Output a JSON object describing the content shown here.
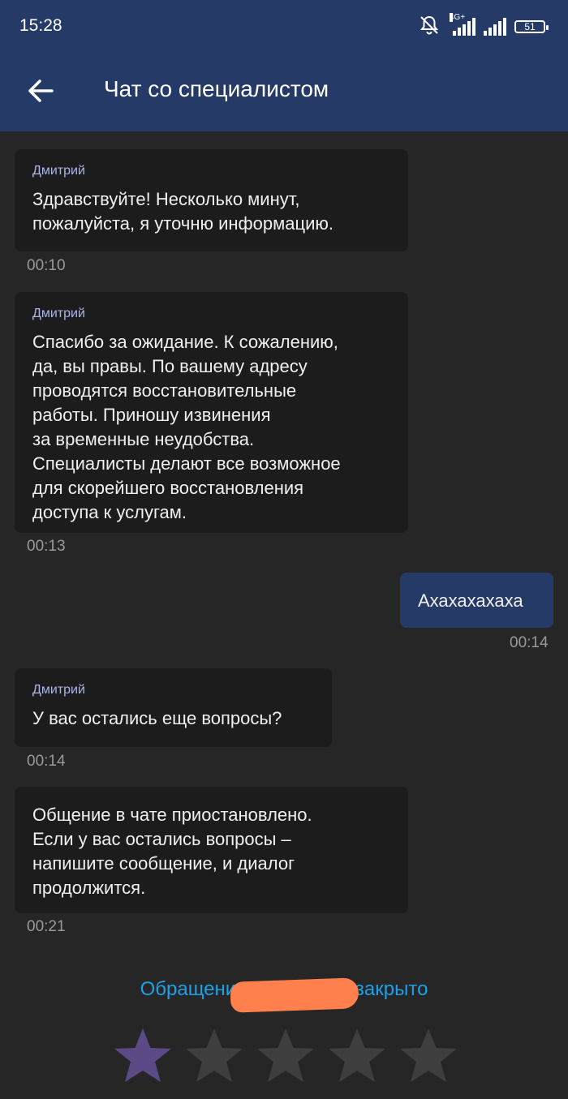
{
  "status_bar": {
    "time": "15:28",
    "network": "4G+",
    "battery": "51"
  },
  "header": {
    "title": "Чат со специалистом"
  },
  "messages": [
    {
      "sender": "Дмитрий",
      "text": "Здравствуйте! Несколько минут,\nпожалуйста, я уточню информацию.",
      "time": "00:10",
      "direction": "incoming"
    },
    {
      "sender": "Дмитрий",
      "text": "Спасибо за ожидание. К сожалению,\nда, вы правы. По вашему адресу\nпроводятся восстановительные\nработы. Приношу извинения\nза временные неудобства.\nСпециалисты делают все возможное\nдля скорейшего восстановления\nдоступа к услугам.",
      "time": "00:13",
      "direction": "incoming"
    },
    {
      "text": "Ахахахахаха",
      "time": "00:14",
      "direction": "outgoing"
    },
    {
      "sender": "Дмитрий",
      "text": "У вас остались еще вопросы?",
      "time": "00:14",
      "direction": "incoming"
    },
    {
      "text": "Общение в чате приостановлено.\nЕсли у вас остались вопросы –\nнапишите сообщение, и диалог\nпродолжится.",
      "time": "00:21",
      "direction": "incoming"
    }
  ],
  "closed_notice": "Обращение #              1 закрыто",
  "rating": {
    "max": 5,
    "value": 1,
    "active_color": "#5b4a86",
    "inactive_color": "#3e3e3e"
  },
  "colors": {
    "header_bg": "#253a66",
    "background": "#262626",
    "bubble_bg": "#1c1c1c",
    "outgoing_bg": "#253a66",
    "link": "#1ea0e6",
    "redaction": "#ff7f4d"
  }
}
